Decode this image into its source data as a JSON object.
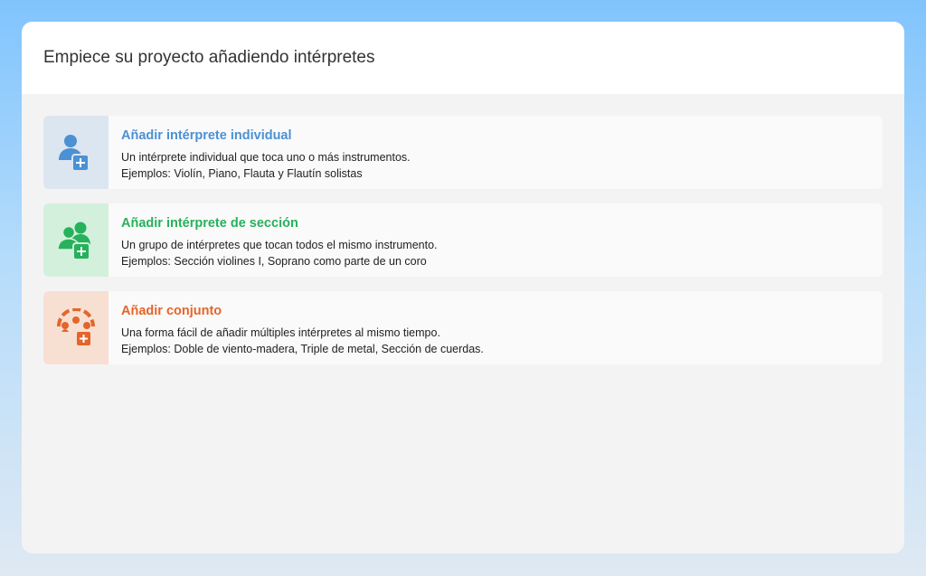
{
  "header": {
    "title": "Empiece su proyecto añadiendo intérpretes"
  },
  "options": [
    {
      "title": "Añadir intérprete individual",
      "description": "Un intérprete individual que toca uno o más instrumentos.",
      "examples": "Ejemplos: Violín, Piano, Flauta y Flautín solistas",
      "icon": "single-person-add-icon",
      "color": "#4b91d3",
      "tile_color": "#dbe6f1"
    },
    {
      "title": "Añadir intérprete de sección",
      "description": "Un grupo de intérpretes que tocan todos el mismo instrumento.",
      "examples": "Ejemplos: Sección violines I, Soprano como parte de un coro",
      "icon": "group-person-add-icon",
      "color": "#27b15b",
      "tile_color": "#d3f0dd"
    },
    {
      "title": "Añadir conjunto",
      "description": "Una forma fácil de añadir múltiples intérpretes al mismo tiempo.",
      "examples": "Ejemplos: Doble de viento-madera, Triple de metal, Sección de cuerdas.",
      "icon": "ensemble-add-icon",
      "color": "#e4652a",
      "tile_color": "#f7dfd2"
    }
  ]
}
